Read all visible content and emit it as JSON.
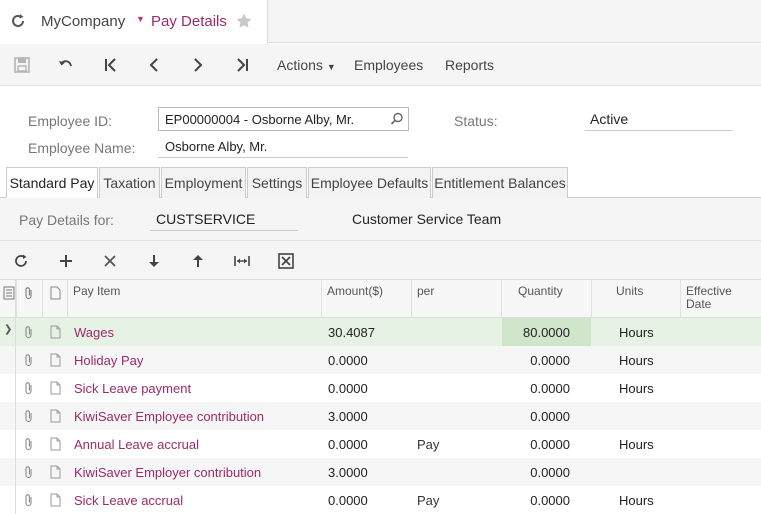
{
  "header": {
    "company": "MyCompany",
    "screen_title": "Pay Details"
  },
  "toolbar": {
    "actions_label": "Actions",
    "employees_label": "Employees",
    "reports_label": "Reports"
  },
  "form": {
    "employee_id_label": "Employee ID:",
    "employee_id_value": "EP00000004 - Osborne Alby, Mr.",
    "employee_name_label": "Employee Name:",
    "employee_name_value": "Osborne Alby, Mr.",
    "status_label": "Status:",
    "status_value": "Active"
  },
  "tabs": [
    {
      "label": "Standard Pay",
      "active": true
    },
    {
      "label": "Taxation",
      "active": false
    },
    {
      "label": "Employment",
      "active": false
    },
    {
      "label": "Settings",
      "active": false
    },
    {
      "label": "Employee Defaults",
      "active": false
    },
    {
      "label": "Entitlement Balances",
      "active": false
    }
  ],
  "pay_details": {
    "label": "Pay Details for:",
    "code": "CUSTSERVICE",
    "description": "Customer Service Team"
  },
  "grid": {
    "columns": {
      "pay_item": "Pay Item",
      "amount": "Amount($)",
      "per": "per",
      "quantity": "Quantity",
      "units": "Units",
      "effective_line1": "Effective",
      "effective_line2": "Date"
    },
    "rows": [
      {
        "pay_item": "Wages",
        "amount": "30.4087",
        "per": "",
        "quantity": "80.0000",
        "units": "Hours"
      },
      {
        "pay_item": "Holiday Pay",
        "amount": "0.0000",
        "per": "",
        "quantity": "0.0000",
        "units": "Hours"
      },
      {
        "pay_item": "Sick Leave payment",
        "amount": "0.0000",
        "per": "",
        "quantity": "0.0000",
        "units": "Hours"
      },
      {
        "pay_item": "KiwiSaver Employee contribution",
        "amount": "3.0000",
        "per": "",
        "quantity": "0.0000",
        "units": ""
      },
      {
        "pay_item": "Annual Leave accrual",
        "amount": "0.0000",
        "per": "Pay",
        "quantity": "0.0000",
        "units": "Hours"
      },
      {
        "pay_item": "KiwiSaver Employer contribution",
        "amount": "3.0000",
        "per": "",
        "quantity": "0.0000",
        "units": ""
      },
      {
        "pay_item": "Sick Leave accrual",
        "amount": "0.0000",
        "per": "Pay",
        "quantity": "0.0000",
        "units": "Hours"
      }
    ]
  },
  "colors": {
    "accent": "#9c2b6a",
    "selected_row": "#e6f2e3"
  }
}
